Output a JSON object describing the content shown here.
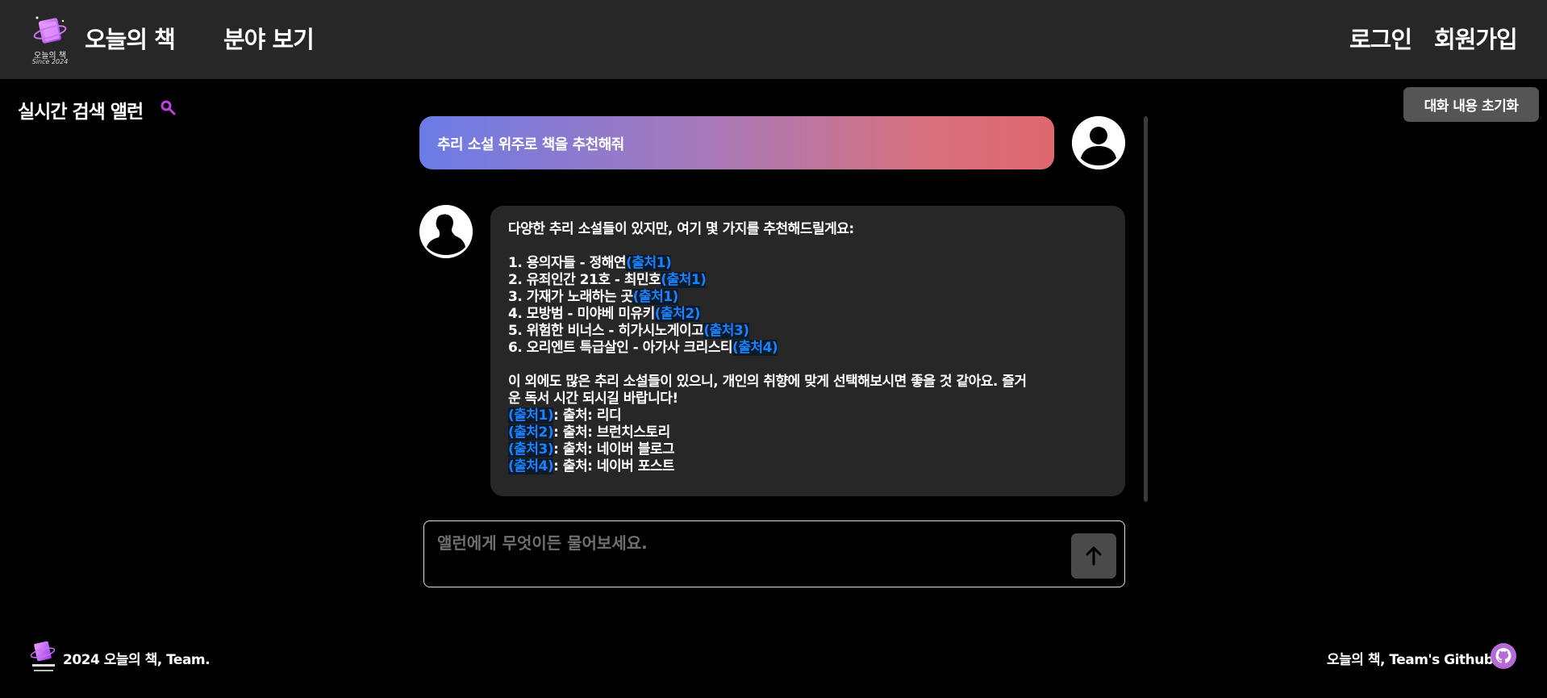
{
  "header": {
    "logo": {
      "line1": "오늘의 책",
      "line2": "Since 2024"
    },
    "brand": "오늘의 책",
    "nav_category": "분야 보기",
    "login": "로그인",
    "signup": "회원가입"
  },
  "sidebar": {
    "label": "실시간 검색 앨런",
    "icon": "search-icon"
  },
  "reset_button": "대화 내용 초기화",
  "chat": {
    "user_message": "추리 소설 위주로 책을 추천해줘",
    "bot": {
      "intro": "다양한 추리 소설들이 있지만, 여기 몇 가지를 추천해드릴게요:",
      "items": [
        {
          "text": "1. 용의자들 - 정해연",
          "cite": "(출처1)"
        },
        {
          "text": "2. 유죄인간 21호 - 최민호",
          "cite": "(출처1)"
        },
        {
          "text": "3. 가재가 노래하는 곳",
          "cite": "(출처1)"
        },
        {
          "text": "4. 모방범 - 미야베 미유키",
          "cite": "(출처2)"
        },
        {
          "text": "5. 위험한 비너스 - 히가시노게이고",
          "cite": "(출처3)"
        },
        {
          "text": "6. 오리엔트 특급살인 - 아가사 크리스티",
          "cite": "(출처4)"
        }
      ],
      "outro_line1": "이 외에도 많은 추리 소설들이 있으니, 개인의 취향에 맞게 선택해보시면 좋을 것 같아요. 즐거",
      "outro_line2": "운 독서 시간 되시길 바랍니다!",
      "sources": [
        {
          "cite": "(출처1)",
          "text": ": 출처: 리디"
        },
        {
          "cite": "(출처2)",
          "text": ": 출처: 브런치스토리"
        },
        {
          "cite": "(출처3)",
          "text": ": 출처: 네이버 블로그"
        },
        {
          "cite": "(출처4)",
          "text": ": 출처: 네이버 포스트"
        }
      ]
    }
  },
  "input": {
    "placeholder": "앨런에게 무엇이든 물어보세요.",
    "value": ""
  },
  "footer": {
    "left": "2024 오늘의 책, Team.",
    "right": "오늘의 책, Team's Github."
  },
  "colors": {
    "header_bg": "#272727",
    "citation": "#1a82ff",
    "bubble_bg": "#272727",
    "accent": "#c040e0"
  }
}
